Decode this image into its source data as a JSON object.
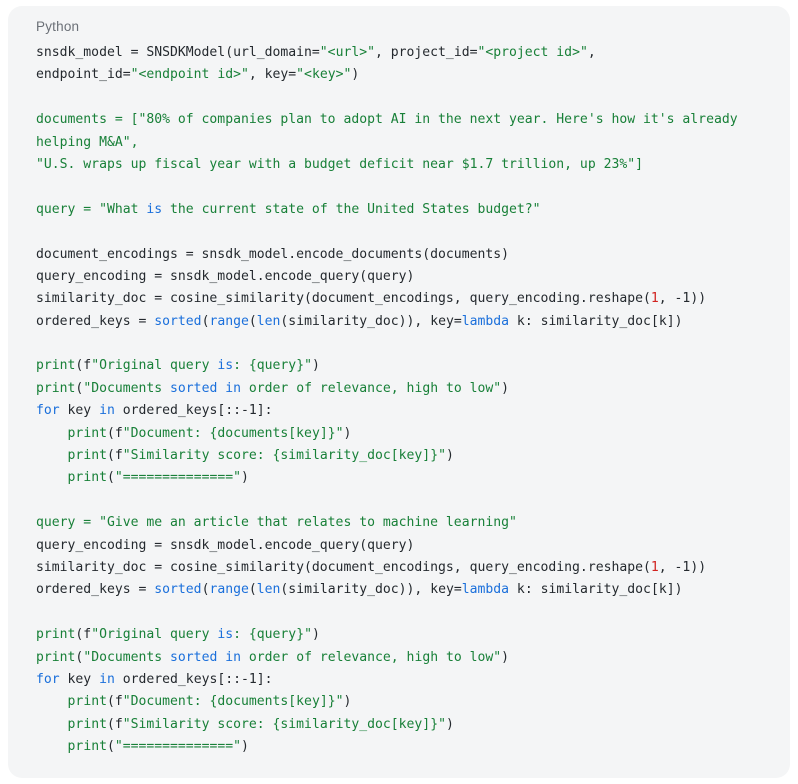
{
  "card": {
    "language_label": "Python",
    "background": "#f4f5f6",
    "text_color": "#24292e"
  },
  "colors": {
    "string": "#188038",
    "keyword": "#1a6fdb",
    "builtin": "#1a6fdb",
    "number": "#d1221f",
    "function": "#188038",
    "plain": "#24292e",
    "label": "#6b7077"
  },
  "code": {
    "language": "python",
    "plain_text": "snsdk_model = SNSDKModel(url_domain=\"<url>\", project_id=\"<project id>\",\nendpoint_id=\"<endpoint id>\", key=\"<key>\")\n\ndocuments = [\"80% of companies plan to adopt AI in the next year. Here's how it's already\nhelping M&A\",\n\"U.S. wraps up fiscal year with a budget deficit near $1.7 trillion, up 23%\"]\n\nquery = \"What is the current state of the United States budget?\"\n\ndocument_encodings = snsdk_model.encode_documents(documents)\nquery_encoding = snsdk_model.encode_query(query)\nsimilarity_doc = cosine_similarity(document_encodings, query_encoding.reshape(1, -1))\nordered_keys = sorted(range(len(similarity_doc)), key=lambda k: similarity_doc[k])\n\nprint(f\"Original query is: {query}\")\nprint(\"Documents sorted in order of relevance, high to low\")\nfor key in ordered_keys[::-1]:\n    print(f\"Document: {documents[key]}\")\n    print(f\"Similarity score: {similarity_doc[key]}\")\n    print(\"==============\")\n\nquery = \"Give me an article that relates to machine learning\"\nquery_encoding = snsdk_model.encode_query(query)\nsimilarity_doc = cosine_similarity(document_encodings, query_encoding.reshape(1, -1))\nordered_keys = sorted(range(len(similarity_doc)), key=lambda k: similarity_doc[k])\n\nprint(f\"Original query is: {query}\")\nprint(\"Documents sorted in order of relevance, high to low\")\nfor key in ordered_keys[::-1]:\n    print(f\"Document: {documents[key]}\")\n    print(f\"Similarity score: {similarity_doc[key]}\")\n    print(\"==============\")",
    "lines": [
      [
        [
          "snsdk_model = SNSDKModel(url_domain=",
          "plain"
        ],
        [
          "\"<url>\"",
          "str"
        ],
        [
          ", project_id=",
          "plain"
        ],
        [
          "\"<project id>\"",
          "str"
        ],
        [
          ",",
          "plain"
        ]
      ],
      [
        [
          "endpoint_id=",
          "plain"
        ],
        [
          "\"<endpoint id>\"",
          "str"
        ],
        [
          ", key=",
          "plain"
        ],
        [
          "\"<key>\"",
          "str"
        ],
        [
          ")",
          "plain"
        ]
      ],
      [],
      [
        [
          "documents = [\"80% of companies plan to adopt AI in the next year. Here's how it's already",
          "str"
        ]
      ],
      [
        [
          "helping M&A\",",
          "str"
        ]
      ],
      [
        [
          "\"U.S. wraps up fiscal year with a budget deficit near $1.7 trillion, up 23%\"]",
          "str"
        ]
      ],
      [],
      [
        [
          "query = \"What ",
          "str"
        ],
        [
          "is",
          "kw"
        ],
        [
          " the current state of the United States budget?\"",
          "str"
        ]
      ],
      [],
      [
        [
          "document_encodings = snsdk_model.encode_documents(documents)",
          "plain"
        ]
      ],
      [
        [
          "query_encoding = snsdk_model.encode_query(query)",
          "plain"
        ]
      ],
      [
        [
          "similarity_doc = cosine_similarity(document_encodings, query_encoding.reshape(",
          "plain"
        ],
        [
          "1",
          "num"
        ],
        [
          ", -1))",
          "plain"
        ]
      ],
      [
        [
          "ordered_keys = ",
          "plain"
        ],
        [
          "sorted",
          "bi"
        ],
        [
          "(",
          "plain"
        ],
        [
          "range",
          "bi"
        ],
        [
          "(",
          "plain"
        ],
        [
          "len",
          "bi"
        ],
        [
          "(similarity_doc)), key=",
          "plain"
        ],
        [
          "lambda",
          "kw"
        ],
        [
          " k: similarity_doc[k])",
          "plain"
        ]
      ],
      [],
      [
        [
          "print",
          "fn"
        ],
        [
          "(f",
          "plain"
        ],
        [
          "\"Original query ",
          "str"
        ],
        [
          "is",
          "kw"
        ],
        [
          ": {query}\"",
          "str"
        ],
        [
          ")",
          "plain"
        ]
      ],
      [
        [
          "print",
          "fn"
        ],
        [
          "(",
          "plain"
        ],
        [
          "\"Documents ",
          "str"
        ],
        [
          "sorted",
          "bi"
        ],
        [
          " ",
          "str"
        ],
        [
          "in",
          "kw"
        ],
        [
          " order of relevance, high to low\"",
          "str"
        ],
        [
          ")",
          "plain"
        ]
      ],
      [
        [
          "for",
          "kw"
        ],
        [
          " key ",
          "plain"
        ],
        [
          "in",
          "kw"
        ],
        [
          " ordered_keys[::-1]:",
          "plain"
        ]
      ],
      [
        [
          "    ",
          "plain"
        ],
        [
          "print",
          "fn"
        ],
        [
          "(f",
          "plain"
        ],
        [
          "\"Document: {documents[key]}\"",
          "str"
        ],
        [
          ")",
          "plain"
        ]
      ],
      [
        [
          "    ",
          "plain"
        ],
        [
          "print",
          "fn"
        ],
        [
          "(f",
          "plain"
        ],
        [
          "\"Similarity score: {similarity_doc[key]}\"",
          "str"
        ],
        [
          ")",
          "plain"
        ]
      ],
      [
        [
          "    ",
          "plain"
        ],
        [
          "print",
          "fn"
        ],
        [
          "(",
          "plain"
        ],
        [
          "\"==============\"",
          "str"
        ],
        [
          ")",
          "plain"
        ]
      ],
      [],
      [
        [
          "query = \"Give me an article that relates to machine learning\"",
          "str"
        ]
      ],
      [
        [
          "query_encoding = snsdk_model.encode_query(query)",
          "plain"
        ]
      ],
      [
        [
          "similarity_doc = cosine_similarity(document_encodings, query_encoding.reshape(",
          "plain"
        ],
        [
          "1",
          "num"
        ],
        [
          ", -1))",
          "plain"
        ]
      ],
      [
        [
          "ordered_keys = ",
          "plain"
        ],
        [
          "sorted",
          "bi"
        ],
        [
          "(",
          "plain"
        ],
        [
          "range",
          "bi"
        ],
        [
          "(",
          "plain"
        ],
        [
          "len",
          "bi"
        ],
        [
          "(similarity_doc)), key=",
          "plain"
        ],
        [
          "lambda",
          "kw"
        ],
        [
          " k: similarity_doc[k])",
          "plain"
        ]
      ],
      [],
      [
        [
          "print",
          "fn"
        ],
        [
          "(f",
          "plain"
        ],
        [
          "\"Original query ",
          "str"
        ],
        [
          "is",
          "kw"
        ],
        [
          ": {query}\"",
          "str"
        ],
        [
          ")",
          "plain"
        ]
      ],
      [
        [
          "print",
          "fn"
        ],
        [
          "(",
          "plain"
        ],
        [
          "\"Documents ",
          "str"
        ],
        [
          "sorted",
          "bi"
        ],
        [
          " ",
          "str"
        ],
        [
          "in",
          "kw"
        ],
        [
          " order of relevance, high to low\"",
          "str"
        ],
        [
          ")",
          "plain"
        ]
      ],
      [
        [
          "for",
          "kw"
        ],
        [
          " key ",
          "plain"
        ],
        [
          "in",
          "kw"
        ],
        [
          " ordered_keys[::-1]:",
          "plain"
        ]
      ],
      [
        [
          "    ",
          "plain"
        ],
        [
          "print",
          "fn"
        ],
        [
          "(f",
          "plain"
        ],
        [
          "\"Document: {documents[key]}\"",
          "str"
        ],
        [
          ")",
          "plain"
        ]
      ],
      [
        [
          "    ",
          "plain"
        ],
        [
          "print",
          "fn"
        ],
        [
          "(f",
          "plain"
        ],
        [
          "\"Similarity score: {similarity_doc[key]}\"",
          "str"
        ],
        [
          ")",
          "plain"
        ]
      ],
      [
        [
          "    ",
          "plain"
        ],
        [
          "print",
          "fn"
        ],
        [
          "(",
          "plain"
        ],
        [
          "\"==============\"",
          "str"
        ],
        [
          ")",
          "plain"
        ]
      ]
    ]
  }
}
